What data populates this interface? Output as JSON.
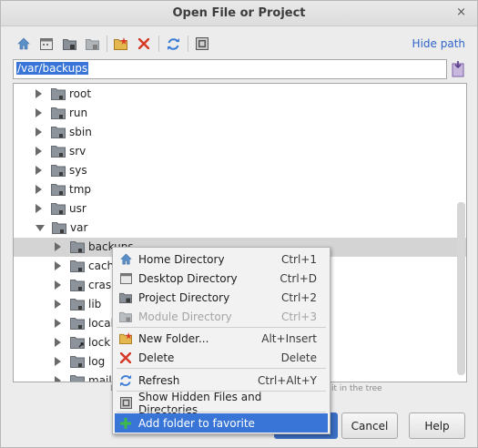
{
  "window": {
    "title": "Open File or Project",
    "close_glyph": "×"
  },
  "toolbar": {
    "icons": [
      "home-icon",
      "desktop-icon",
      "project-icon",
      "module-icon",
      "new-folder-icon",
      "delete-icon",
      "refresh-icon",
      "show-hidden-icon"
    ],
    "hide_path_label": "Hide path"
  },
  "path": {
    "value": "/var/backups"
  },
  "tree": {
    "items": [
      {
        "label": "root",
        "level": 0,
        "expanded": false
      },
      {
        "label": "run",
        "level": 0,
        "expanded": false
      },
      {
        "label": "sbin",
        "level": 0,
        "expanded": false
      },
      {
        "label": "srv",
        "level": 0,
        "expanded": false
      },
      {
        "label": "sys",
        "level": 0,
        "expanded": false
      },
      {
        "label": "tmp",
        "level": 0,
        "expanded": false
      },
      {
        "label": "usr",
        "level": 0,
        "expanded": false
      },
      {
        "label": "var",
        "level": 0,
        "expanded": true
      },
      {
        "label": "backups",
        "level": 1,
        "expanded": false,
        "selected": true
      },
      {
        "label": "cache",
        "level": 1,
        "expanded": false
      },
      {
        "label": "crash",
        "level": 1,
        "expanded": false
      },
      {
        "label": "lib",
        "level": 1,
        "expanded": false
      },
      {
        "label": "local",
        "level": 1,
        "expanded": false
      },
      {
        "label": "lock",
        "level": 1,
        "expanded": false
      },
      {
        "label": "log",
        "level": 1,
        "expanded": false
      },
      {
        "label": "mail",
        "level": 1,
        "expanded": false
      }
    ]
  },
  "hint": {
    "left": "D",
    "right": "it in the tree"
  },
  "buttons": {
    "cancel": "Cancel",
    "help": "Help"
  },
  "context_menu": {
    "items": [
      {
        "label": "Home Directory",
        "shortcut": "Ctrl+1",
        "icon": "home-icon"
      },
      {
        "label": "Desktop Directory",
        "shortcut": "Ctrl+D",
        "icon": "desktop-icon"
      },
      {
        "label": "Project Directory",
        "shortcut": "Ctrl+2",
        "icon": "project-icon"
      },
      {
        "label": "Module Directory",
        "shortcut": "Ctrl+3",
        "icon": "module-icon",
        "disabled": true
      },
      {
        "label": "New Folder...",
        "shortcut": "Alt+Insert",
        "icon": "new-folder-icon"
      },
      {
        "label": "Delete",
        "shortcut": "Delete",
        "icon": "delete-icon"
      },
      {
        "label": "Refresh",
        "shortcut": "Ctrl+Alt+Y",
        "icon": "refresh-icon"
      },
      {
        "label": "Show Hidden Files and Directories",
        "shortcut": "",
        "icon": "show-hidden-icon"
      },
      {
        "label": "Add folder to favorite",
        "shortcut": "",
        "icon": "add-favorite-icon",
        "highlighted": true
      }
    ]
  },
  "colors": {
    "accent": "#3875d7",
    "link": "#2f65ca",
    "selection_row": "#d4d4d4",
    "delete_red": "#d63a2b",
    "refresh_blue": "#3a7bd5"
  }
}
